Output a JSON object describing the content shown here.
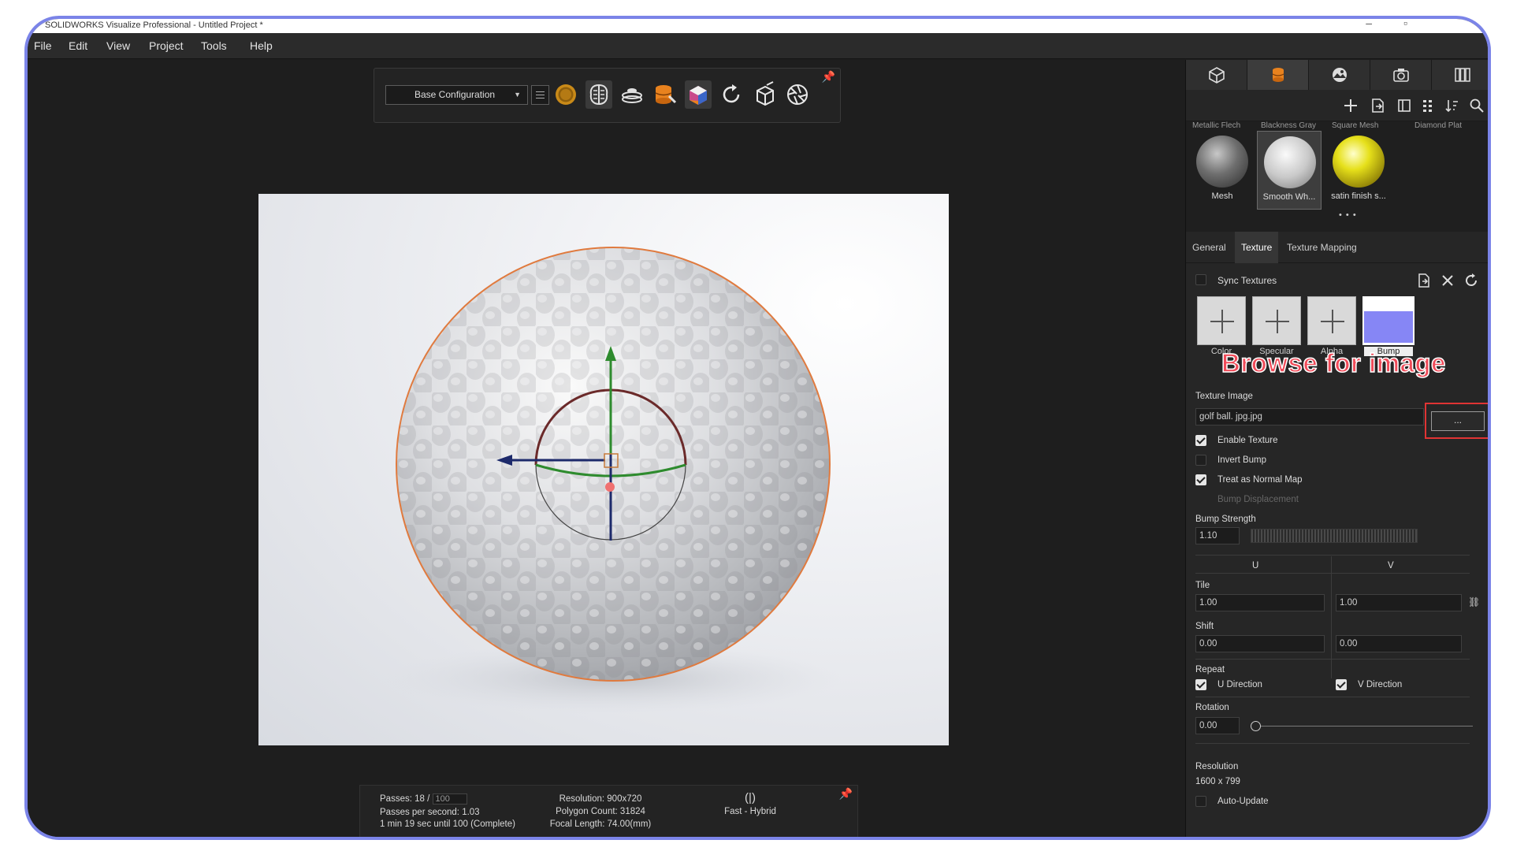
{
  "window": {
    "title": "SOLIDWORKS Visualize Professional - Untitled Project *"
  },
  "menu": [
    "File",
    "Edit",
    "View",
    "Project",
    "Tools",
    "Help"
  ],
  "toolbar": {
    "configuration": "Base Configuration"
  },
  "status": {
    "passes_label": "Passes: 18 /",
    "passes_total": "100",
    "passes_per_second": "Passes per second: 1.03",
    "time_remaining": "1 min 19 sec until 100 (Complete)",
    "resolution": "Resolution: 900x720",
    "polygon_count": "Polygon Count: 31824",
    "focal_length": "Focal Length: 74.00(mm)",
    "render_mode": "Fast - Hybrid"
  },
  "library": {
    "prev_labels": [
      "Metallic Flech",
      "Blackness Gray",
      "Square Mesh",
      "Diamond Plat"
    ],
    "items": [
      {
        "label": "Mesh"
      },
      {
        "label": "Smooth Wh..."
      },
      {
        "label": "satin finish s..."
      }
    ]
  },
  "subtabs": [
    "General",
    "Texture",
    "Texture Mapping"
  ],
  "texture": {
    "sync_textures": "Sync Textures",
    "slots": [
      "Color",
      "Specular",
      "Alpha",
      "Bump"
    ],
    "annotation": "Browse for image",
    "texture_image_label": "Texture Image",
    "texture_image_value": "golf ball. jpg.jpg",
    "browse_button": "...",
    "enable_texture": "Enable Texture",
    "invert_bump": "Invert Bump",
    "treat_as_normal_map": "Treat as Normal Map",
    "bump_displacement": "Bump Displacement",
    "bump_strength_label": "Bump Strength",
    "bump_strength_value": "1.10",
    "u_header": "U",
    "v_header": "V",
    "tile_label": "Tile",
    "tile_u": "1.00",
    "tile_v": "1.00",
    "shift_label": "Shift",
    "shift_u": "0.00",
    "shift_v": "0.00",
    "repeat_label": "Repeat",
    "u_direction": "U Direction",
    "v_direction": "V Direction",
    "rotation_label": "Rotation",
    "rotation_value": "0.00",
    "resolution_label": "Resolution",
    "resolution_value": "1600 x 799",
    "auto_update": "Auto-Update"
  },
  "colors": {
    "accent_orange": "#e8821e",
    "annotation_red": "#e03434",
    "bump_preview": "#8686f5",
    "frame_border": "#7b84e8"
  }
}
